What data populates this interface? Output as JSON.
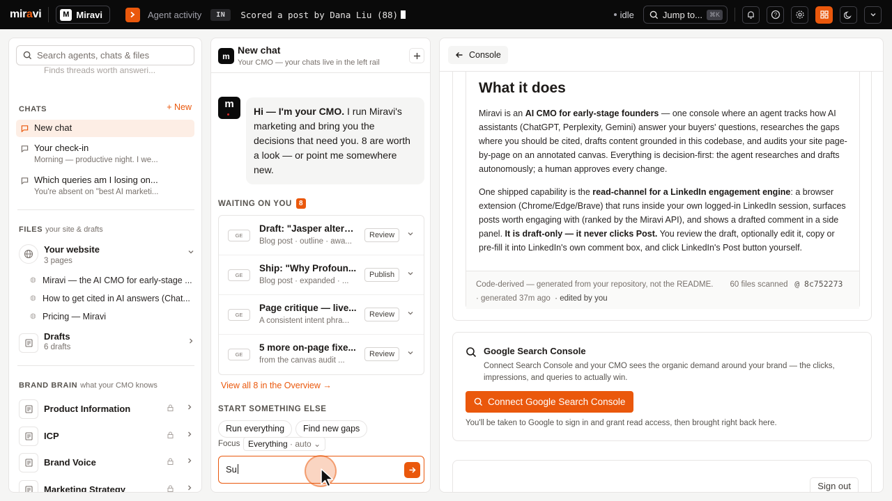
{
  "topbar": {
    "logo": {
      "pre": "mir",
      "accent": "a",
      "post": "vi"
    },
    "workspace": {
      "badge": "M",
      "name": "Miravi"
    },
    "agent_icon": "chevron-right-icon",
    "agent_label": "Agent activity",
    "in_pill": "IN",
    "ticker": "Scored a post by Dana Liu (88)",
    "status": "idle",
    "jump_label": "Jump to...",
    "jump_kbd": "⌘K",
    "icons": [
      "bell-icon",
      "help-icon",
      "gear-icon",
      "grid-icon",
      "moon-icon",
      "chevron-down-icon"
    ],
    "accent": "#ea580c"
  },
  "sidebar": {
    "search_placeholder": "Search agents, chats & files",
    "faded_preview": "Finds threads worth answeri...",
    "chats_header": "CHATS",
    "new_label": "+ New",
    "chats": [
      {
        "title": "New chat",
        "preview": "",
        "active": true
      },
      {
        "title": "Your check-in",
        "preview": "Morning — productive night. I we...",
        "active": false
      },
      {
        "title": "Which queries am I losing on...",
        "preview": "You're absent on \"best AI marketi...",
        "active": false
      }
    ],
    "files_header": "FILES",
    "files_sub": "your site & drafts",
    "website": {
      "title": "Your website",
      "sub": "3 pages"
    },
    "pages": [
      "Miravi — the AI CMO for early-stage ...",
      "How to get cited in AI answers (Chat...",
      "Pricing — Miravi"
    ],
    "drafts": {
      "title": "Drafts",
      "sub": "6 drafts"
    },
    "brain_header": "BRAND BRAIN",
    "brain_sub": "what your CMO knows",
    "brain": [
      "Product Information",
      "ICP",
      "Brand Voice",
      "Marketing Strategy"
    ]
  },
  "chat": {
    "title": "New chat",
    "subtitle": "Your CMO — your chats live in the left rail",
    "avatar": "m",
    "greeting_bold": "Hi — I'm your CMO.",
    "greeting_rest": " I run Miravi's marketing and bring you the decisions that need you. 8 are worth a look — or point me somewhere new.",
    "waiting_label": "WAITING ON YOU",
    "waiting_count": "8",
    "queue": [
      {
        "tag": "GE",
        "title": "Draft: \"Jasper altern...",
        "sub": "Blog post · outline · awa...",
        "action": "Review"
      },
      {
        "tag": "GE",
        "title": "Ship: \"Why Profoun...",
        "sub": "Blog post · expanded · ...",
        "action": "Publish"
      },
      {
        "tag": "GE",
        "title": "Page critique — live...",
        "sub": "A consistent intent phra...",
        "action": "Review"
      },
      {
        "tag": "GE",
        "title": "5 more on-page fixe...",
        "sub": "from the canvas audit ...",
        "action": "Review"
      }
    ],
    "view_all": "View all 8 in the Overview →",
    "start_label": "START SOMETHING ELSE",
    "chips": [
      "Run everything",
      "Find new gaps"
    ],
    "focus_label": "Focus",
    "focus_value": "Everything",
    "focus_mode": "· auto",
    "input_value": "Su"
  },
  "console": {
    "back_label": "Console",
    "what_title": "What it does",
    "p1_a": "Miravi is an ",
    "p1_b": "AI CMO for early-stage founders",
    "p1_c": " — one console where an agent tracks how AI assistants (ChatGPT, Perplexity, Gemini) answer your buyers' questions, researches the gaps where you should be cited, drafts content grounded in this codebase, and audits your site page-by-page on an annotated canvas. Everything is decision-first: the agent researches and drafts autonomously; a human approves every change.",
    "p2_a": "One shipped capability is the ",
    "p2_b": "read-channel for a LinkedIn engagement engine",
    "p2_c": ": a browser extension (Chrome/Edge/Brave) that runs inside your own logged-in LinkedIn session, surfaces posts worth engaging with (ranked by the Miravi API), and shows a drafted comment in a side panel. ",
    "p2_d": "It is draft-only — it never clicks Post.",
    "p2_e": " You review the draft, optionally edit it, copy or pre-fill it into LinkedIn's own comment box, and click LinkedIn's Post button yourself.",
    "foot_derived": "Code-derived — generated from your repository, not the README.",
    "foot_files": "60 files scanned",
    "foot_hash": "@ 8c752273",
    "foot_generated": "· generated 37m ago",
    "foot_edited": "· edited by you",
    "gsc_title": "Google Search Console",
    "gsc_desc": "Connect Search Console and your CMO sees the organic demand around your brand — the clicks, impressions, and queries to actually win.",
    "gsc_button": "Connect Google Search Console",
    "gsc_note": "You'll be taken to Google to sign in and grant read access, then brought right back here.",
    "sign_out": "Sign out"
  }
}
